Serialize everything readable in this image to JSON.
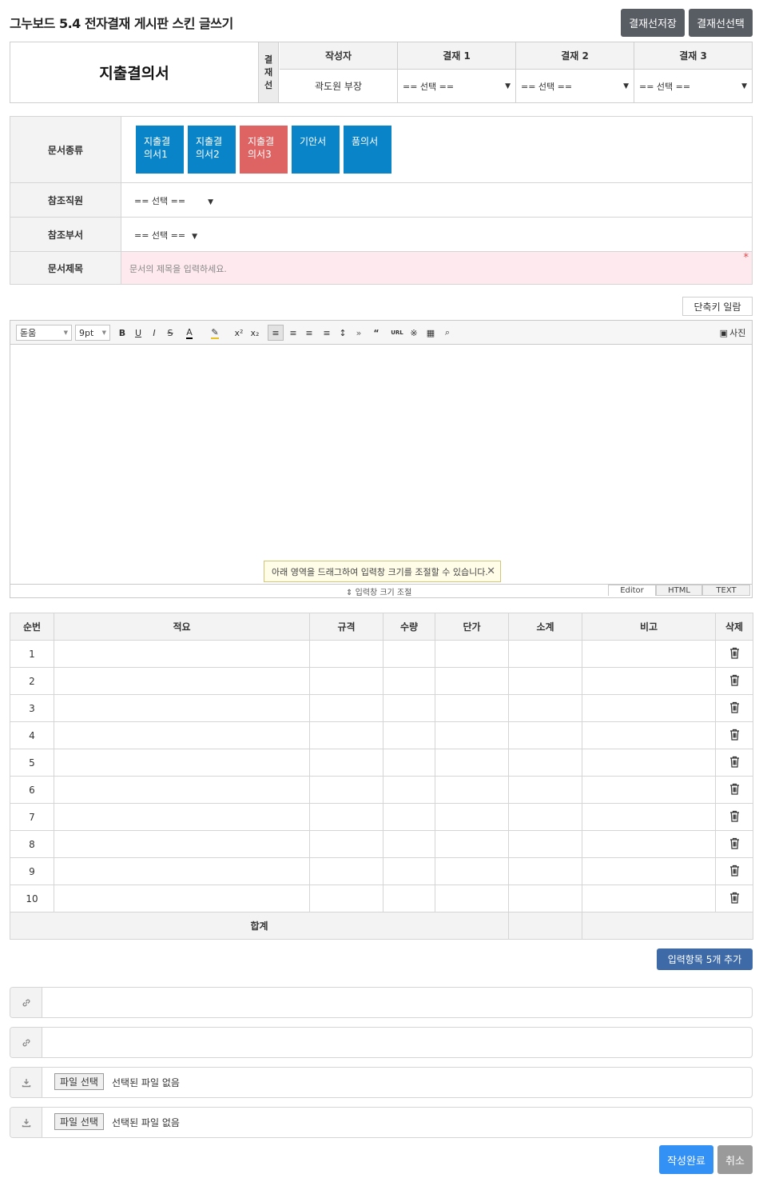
{
  "header": {
    "title": "그누보드 5.4 전자결재 게시판 스킨 글쓰기",
    "save_line_btn": "결재선저장",
    "select_line_btn": "결재선선택"
  },
  "approval": {
    "doc_title": "지출결의서",
    "line_label": "결\n재\n선",
    "columns": [
      {
        "header": "작성자",
        "value": "곽도원 부장"
      },
      {
        "header": "결재 1",
        "value": "== 선택 =="
      },
      {
        "header": "결재 2",
        "value": "== 선택 =="
      },
      {
        "header": "결재 3",
        "value": "== 선택 =="
      }
    ]
  },
  "form": {
    "doctype_label": "문서종류",
    "doctypes": [
      {
        "label": "지출결\n의서1",
        "active": false
      },
      {
        "label": "지출결\n의서2",
        "active": false
      },
      {
        "label": "지출결\n의서3",
        "active": true
      },
      {
        "label": "기안서",
        "active": false
      },
      {
        "label": "품의서",
        "active": false
      }
    ],
    "ref_staff_label": "참조직원",
    "ref_staff_value": "== 선택 ==",
    "ref_dept_label": "참조부서",
    "ref_dept_value": "== 선택 ==",
    "subject_label": "문서제목",
    "subject_placeholder": "문서의 제목을 입력하세요.",
    "required_mark": "*"
  },
  "editor": {
    "shortcut_btn": "단축키 일람",
    "font": "돋움",
    "size": "9pt",
    "photo_btn": "사진",
    "resize_tip": "아래 영역을 드래그하여 입력창 크기를 조절할 수 있습니다.",
    "resize_label": "입력창 크기 조절",
    "modes": [
      "Editor",
      "HTML",
      "TEXT"
    ]
  },
  "items": {
    "headers": [
      "순번",
      "적요",
      "규격",
      "수량",
      "단가",
      "소계",
      "비고",
      "삭제"
    ],
    "rows": [
      "1",
      "2",
      "3",
      "4",
      "5",
      "6",
      "7",
      "8",
      "9",
      "10"
    ],
    "total_label": "합계",
    "add_btn": "입력항목 5개 추가"
  },
  "attachments": {
    "file_btn": "파일 선택",
    "no_file": "선택된 파일 없음"
  },
  "actions": {
    "submit": "작성완료",
    "cancel": "취소"
  }
}
